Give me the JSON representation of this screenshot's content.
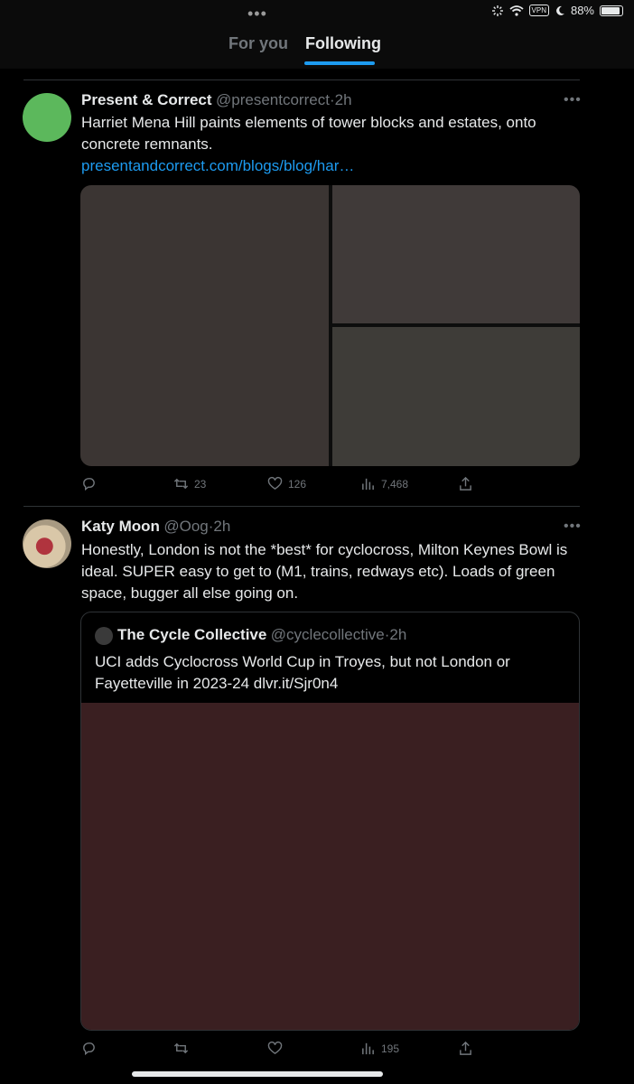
{
  "status_bar": {
    "dots": "•••",
    "battery": "88%",
    "vpn": "VPN"
  },
  "tabs": [
    {
      "label": "For you"
    },
    {
      "label": "Following"
    }
  ],
  "posts": [
    {
      "name": "Present & Correct",
      "handle": "@presentcorrect",
      "time": "2h",
      "text": "Harriet Mena Hill paints elements of tower blocks and estates, onto concrete remnants.",
      "link": "presentandcorrect.com/blogs/blog/har…",
      "stats": {
        "reply": "",
        "retweet": "23",
        "like": "126",
        "views": "7,468"
      }
    },
    {
      "name": "Katy Moon",
      "handle": "@Oog",
      "time": "2h",
      "text": "Honestly, London is not the *best* for cyclocross, Milton Keynes Bowl is ideal. SUPER easy to get to (M1, trains, redways etc). Loads of green space, bugger all else going on.",
      "quote": {
        "name": "The Cycle Collective",
        "handle": "@cyclecollective",
        "time": "2h",
        "text": "UCI adds Cyclocross World Cup in Troyes, but not London or Fayetteville in 2023-24 dlvr.it/Sjr0n4"
      },
      "stats": {
        "reply": "",
        "retweet": "",
        "like": "",
        "views": "195"
      }
    }
  ],
  "colors": {
    "accent": "#1d9bf0",
    "muted": "#71767b",
    "avatar1": "#5cb85c"
  },
  "icons": [
    "reply-icon",
    "retweet-icon",
    "like-icon",
    "views-icon",
    "share-icon",
    "more-icon",
    "wifi-icon",
    "moon-icon",
    "battery-icon"
  ]
}
